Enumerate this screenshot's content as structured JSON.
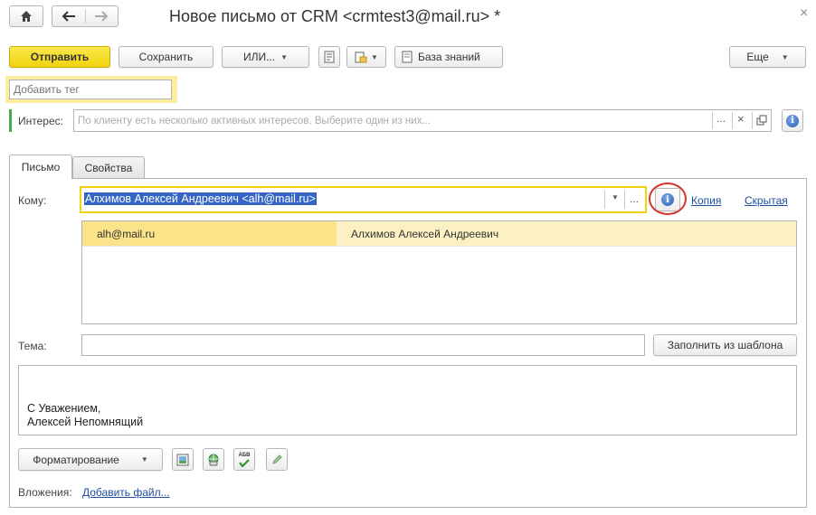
{
  "window": {
    "title": "Новое письмо от CRM <crmtest3@mail.ru> *",
    "close_glyph": "×"
  },
  "toolbar": {
    "send_label": "Отправить",
    "save_label": "Сохранить",
    "or_label": "ИЛИ...",
    "knowledge_base_label": "База знаний",
    "more_label": "Еще"
  },
  "tag_input": {
    "placeholder": "Добавить тег"
  },
  "interest": {
    "label": "Интерес:",
    "placeholder": "По клиенту есть несколько активных интересов. Выберите один из них...",
    "ellipsis": "...",
    "clear": "×"
  },
  "tabs": [
    {
      "label": "Письмо",
      "active": true
    },
    {
      "label": "Свойства",
      "active": false
    }
  ],
  "to": {
    "label": "Кому:",
    "value": "Алхимов Алексей Андреевич <alh@mail.ru>",
    "ellipsis": "...",
    "copy_link": "Копия",
    "hidden_link": "Скрытая"
  },
  "recipients": [
    {
      "email": "alh@mail.ru",
      "name": "Алхимов Алексей Андреевич"
    }
  ],
  "subject": {
    "label": "Тема:",
    "value": "",
    "fill_template_label": "Заполнить из шаблона"
  },
  "body": {
    "signature_line1": "С Уважением,",
    "signature_line2": "Алексей Непомнящий"
  },
  "bottom_toolbar": {
    "formatting_label": "Форматирование",
    "spell_icon_text": "АБВ"
  },
  "attachments": {
    "label": "Вложения:",
    "add_file_link": "Добавить файл..."
  },
  "colors": {
    "accent_yellow": "#f0d20f",
    "highlight": "#fbeea0",
    "link": "#1e4fa0",
    "annotation_red": "#d9302b"
  }
}
